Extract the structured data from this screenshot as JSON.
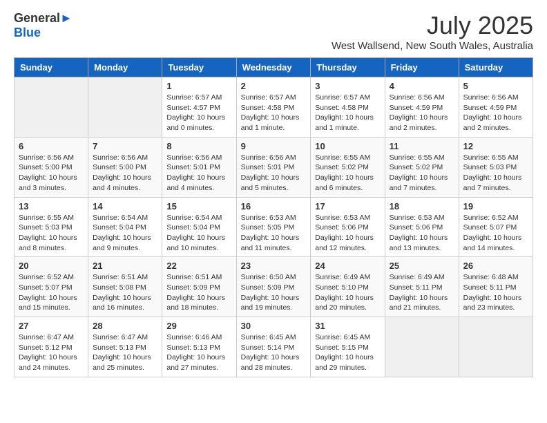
{
  "header": {
    "logo_general": "General",
    "logo_blue": "Blue",
    "month_title": "July 2025",
    "location": "West Wallsend, New South Wales, Australia"
  },
  "columns": [
    "Sunday",
    "Monday",
    "Tuesday",
    "Wednesday",
    "Thursday",
    "Friday",
    "Saturday"
  ],
  "weeks": [
    [
      {
        "day": "",
        "info": ""
      },
      {
        "day": "",
        "info": ""
      },
      {
        "day": "1",
        "info": "Sunrise: 6:57 AM\nSunset: 4:57 PM\nDaylight: 10 hours and 0 minutes."
      },
      {
        "day": "2",
        "info": "Sunrise: 6:57 AM\nSunset: 4:58 PM\nDaylight: 10 hours and 1 minute."
      },
      {
        "day": "3",
        "info": "Sunrise: 6:57 AM\nSunset: 4:58 PM\nDaylight: 10 hours and 1 minute."
      },
      {
        "day": "4",
        "info": "Sunrise: 6:56 AM\nSunset: 4:59 PM\nDaylight: 10 hours and 2 minutes."
      },
      {
        "day": "5",
        "info": "Sunrise: 6:56 AM\nSunset: 4:59 PM\nDaylight: 10 hours and 2 minutes."
      }
    ],
    [
      {
        "day": "6",
        "info": "Sunrise: 6:56 AM\nSunset: 5:00 PM\nDaylight: 10 hours and 3 minutes."
      },
      {
        "day": "7",
        "info": "Sunrise: 6:56 AM\nSunset: 5:00 PM\nDaylight: 10 hours and 4 minutes."
      },
      {
        "day": "8",
        "info": "Sunrise: 6:56 AM\nSunset: 5:01 PM\nDaylight: 10 hours and 4 minutes."
      },
      {
        "day": "9",
        "info": "Sunrise: 6:56 AM\nSunset: 5:01 PM\nDaylight: 10 hours and 5 minutes."
      },
      {
        "day": "10",
        "info": "Sunrise: 6:55 AM\nSunset: 5:02 PM\nDaylight: 10 hours and 6 minutes."
      },
      {
        "day": "11",
        "info": "Sunrise: 6:55 AM\nSunset: 5:02 PM\nDaylight: 10 hours and 7 minutes."
      },
      {
        "day": "12",
        "info": "Sunrise: 6:55 AM\nSunset: 5:03 PM\nDaylight: 10 hours and 7 minutes."
      }
    ],
    [
      {
        "day": "13",
        "info": "Sunrise: 6:55 AM\nSunset: 5:03 PM\nDaylight: 10 hours and 8 minutes."
      },
      {
        "day": "14",
        "info": "Sunrise: 6:54 AM\nSunset: 5:04 PM\nDaylight: 10 hours and 9 minutes."
      },
      {
        "day": "15",
        "info": "Sunrise: 6:54 AM\nSunset: 5:04 PM\nDaylight: 10 hours and 10 minutes."
      },
      {
        "day": "16",
        "info": "Sunrise: 6:53 AM\nSunset: 5:05 PM\nDaylight: 10 hours and 11 minutes."
      },
      {
        "day": "17",
        "info": "Sunrise: 6:53 AM\nSunset: 5:06 PM\nDaylight: 10 hours and 12 minutes."
      },
      {
        "day": "18",
        "info": "Sunrise: 6:53 AM\nSunset: 5:06 PM\nDaylight: 10 hours and 13 minutes."
      },
      {
        "day": "19",
        "info": "Sunrise: 6:52 AM\nSunset: 5:07 PM\nDaylight: 10 hours and 14 minutes."
      }
    ],
    [
      {
        "day": "20",
        "info": "Sunrise: 6:52 AM\nSunset: 5:07 PM\nDaylight: 10 hours and 15 minutes."
      },
      {
        "day": "21",
        "info": "Sunrise: 6:51 AM\nSunset: 5:08 PM\nDaylight: 10 hours and 16 minutes."
      },
      {
        "day": "22",
        "info": "Sunrise: 6:51 AM\nSunset: 5:09 PM\nDaylight: 10 hours and 18 minutes."
      },
      {
        "day": "23",
        "info": "Sunrise: 6:50 AM\nSunset: 5:09 PM\nDaylight: 10 hours and 19 minutes."
      },
      {
        "day": "24",
        "info": "Sunrise: 6:49 AM\nSunset: 5:10 PM\nDaylight: 10 hours and 20 minutes."
      },
      {
        "day": "25",
        "info": "Sunrise: 6:49 AM\nSunset: 5:11 PM\nDaylight: 10 hours and 21 minutes."
      },
      {
        "day": "26",
        "info": "Sunrise: 6:48 AM\nSunset: 5:11 PM\nDaylight: 10 hours and 23 minutes."
      }
    ],
    [
      {
        "day": "27",
        "info": "Sunrise: 6:47 AM\nSunset: 5:12 PM\nDaylight: 10 hours and 24 minutes."
      },
      {
        "day": "28",
        "info": "Sunrise: 6:47 AM\nSunset: 5:13 PM\nDaylight: 10 hours and 25 minutes."
      },
      {
        "day": "29",
        "info": "Sunrise: 6:46 AM\nSunset: 5:13 PM\nDaylight: 10 hours and 27 minutes."
      },
      {
        "day": "30",
        "info": "Sunrise: 6:45 AM\nSunset: 5:14 PM\nDaylight: 10 hours and 28 minutes."
      },
      {
        "day": "31",
        "info": "Sunrise: 6:45 AM\nSunset: 5:15 PM\nDaylight: 10 hours and 29 minutes."
      },
      {
        "day": "",
        "info": ""
      },
      {
        "day": "",
        "info": ""
      }
    ]
  ]
}
